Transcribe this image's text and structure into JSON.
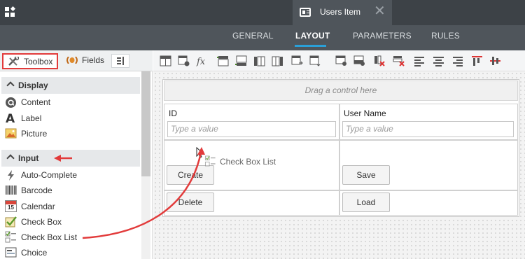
{
  "window": {
    "doc_tab_title": "Users Item",
    "close_glyph": "✕"
  },
  "nav": {
    "tabs": [
      {
        "label": "GENERAL",
        "active": false
      },
      {
        "label": "LAYOUT",
        "active": true
      },
      {
        "label": "PARAMETERS",
        "active": false
      },
      {
        "label": "RULES",
        "active": false
      }
    ]
  },
  "panel": {
    "tabs": {
      "toolbox": "Toolbox",
      "fields": "Fields"
    },
    "sections": [
      {
        "title": "Display",
        "items": [
          {
            "label": "Content",
            "icon": "content-icon"
          },
          {
            "label": "Label",
            "icon": "label-icon"
          },
          {
            "label": "Picture",
            "icon": "picture-icon"
          }
        ]
      },
      {
        "title": "Input",
        "items": [
          {
            "label": "Auto-Complete",
            "icon": "auto-complete-icon"
          },
          {
            "label": "Barcode",
            "icon": "barcode-icon"
          },
          {
            "label": "Calendar",
            "icon": "calendar-icon"
          },
          {
            "label": "Check Box",
            "icon": "check-box-icon"
          },
          {
            "label": "Check Box List",
            "icon": "check-box-list-icon"
          },
          {
            "label": "Choice",
            "icon": "choice-icon"
          }
        ]
      }
    ],
    "calendar_day": "15"
  },
  "form": {
    "drag_hint": "Drag a control here",
    "id_label": "ID",
    "username_label": "User Name",
    "id_placeholder": "Type a value",
    "username_placeholder": "Type a value",
    "buttons": {
      "create": "Create",
      "save": "Save",
      "delete": "Delete",
      "load": "Load"
    },
    "drag_ghost_label": "Check Box List"
  },
  "colors": {
    "annotation_red": "#e23b3b",
    "accent_blue": "#2aa0d8",
    "topbar": "#3d4247"
  }
}
